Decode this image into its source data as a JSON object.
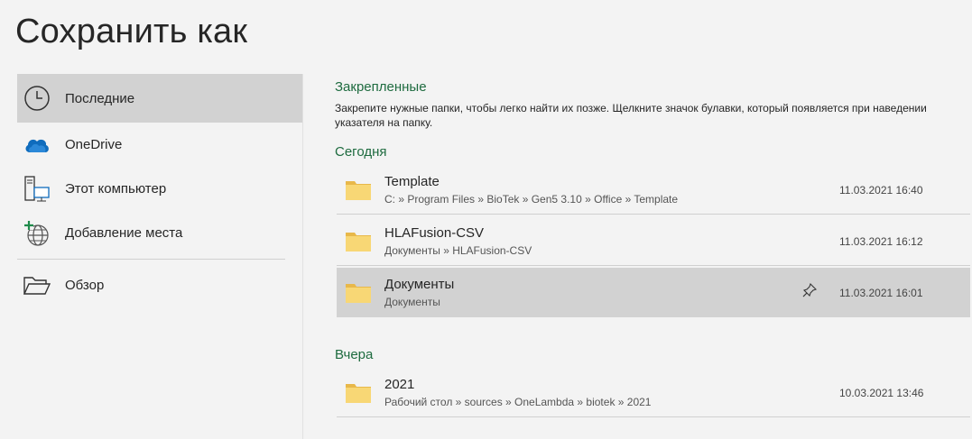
{
  "title": "Сохранить как",
  "nav": {
    "items": [
      {
        "label": "Последние",
        "icon": "clock-icon"
      },
      {
        "label": "OneDrive",
        "icon": "cloud-icon"
      },
      {
        "label": "Этот компьютер",
        "icon": "computer-icon"
      },
      {
        "label": "Добавление места",
        "icon": "add-globe-icon"
      },
      {
        "label": "Обзор",
        "icon": "open-folder-icon"
      }
    ],
    "selected": "Последние"
  },
  "pinned": {
    "title": "Закрепленные",
    "description": "Закрепите нужные папки, чтобы легко найти их позже. Щелкните значок булавки, который появляется при наведении указателя на папку."
  },
  "groups": [
    {
      "title": "Сегодня",
      "items": [
        {
          "name": "Template",
          "path": "C: » Program Files » BioTek » Gen5 3.10 » Office » Template",
          "date": "11.03.2021 16:40"
        },
        {
          "name": "HLAFusion-CSV",
          "path": "Документы » HLAFusion-CSV",
          "date": "11.03.2021 16:12"
        },
        {
          "name": "Документы",
          "path": "Документы",
          "date": "11.03.2021 16:01"
        }
      ]
    },
    {
      "title": "Вчера",
      "items": [
        {
          "name": "2021",
          "path": "Рабочий стол » sources » OneLambda » biotek » 2021",
          "date": "10.03.2021 13:46"
        }
      ]
    }
  ],
  "colors": {
    "accent_green": "#1e6b3f",
    "selected_bg": "#d2d2d2",
    "folder": "#f8d775"
  }
}
